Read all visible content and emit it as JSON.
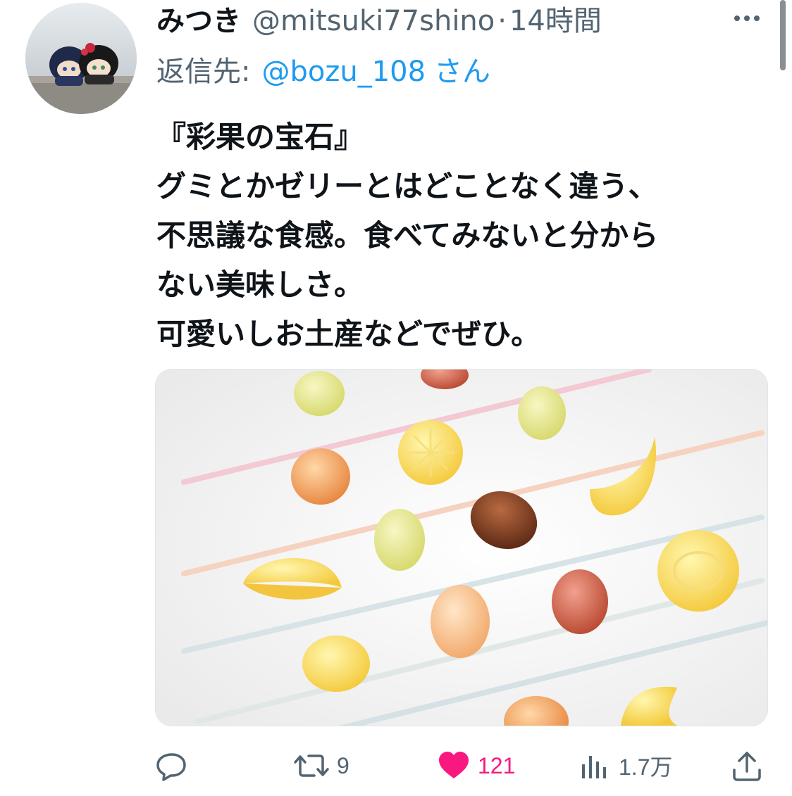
{
  "tweet": {
    "display_name": "みつき",
    "handle": "@mitsuki77shino",
    "separator": "·",
    "time": "14時間",
    "reply": {
      "prefix": "返信先:",
      "handle": "@bozu_108",
      "suffix": "さん"
    },
    "text_lines": [
      "『彩果の宝石』",
      "グミとかゼリーとはどことなく違う、",
      "不思議な食感。食べてみないと分から",
      "ない美味しさ。",
      "可愛いしお土産などでぜひ。"
    ],
    "media_icon": "fruit-jelly-photo",
    "actions": {
      "reply": {
        "icon": "reply-icon",
        "count": ""
      },
      "retweet": {
        "icon": "retweet-icon",
        "count": "9"
      },
      "like": {
        "icon": "heart-icon",
        "count": "121",
        "liked": true
      },
      "views": {
        "icon": "views-icon",
        "count": "1.7万"
      },
      "share": {
        "icon": "share-icon",
        "count": ""
      }
    }
  },
  "colors": {
    "accent": "#1d9bf0",
    "muted": "#536471",
    "text": "#0f1419",
    "like": "#f91880"
  }
}
